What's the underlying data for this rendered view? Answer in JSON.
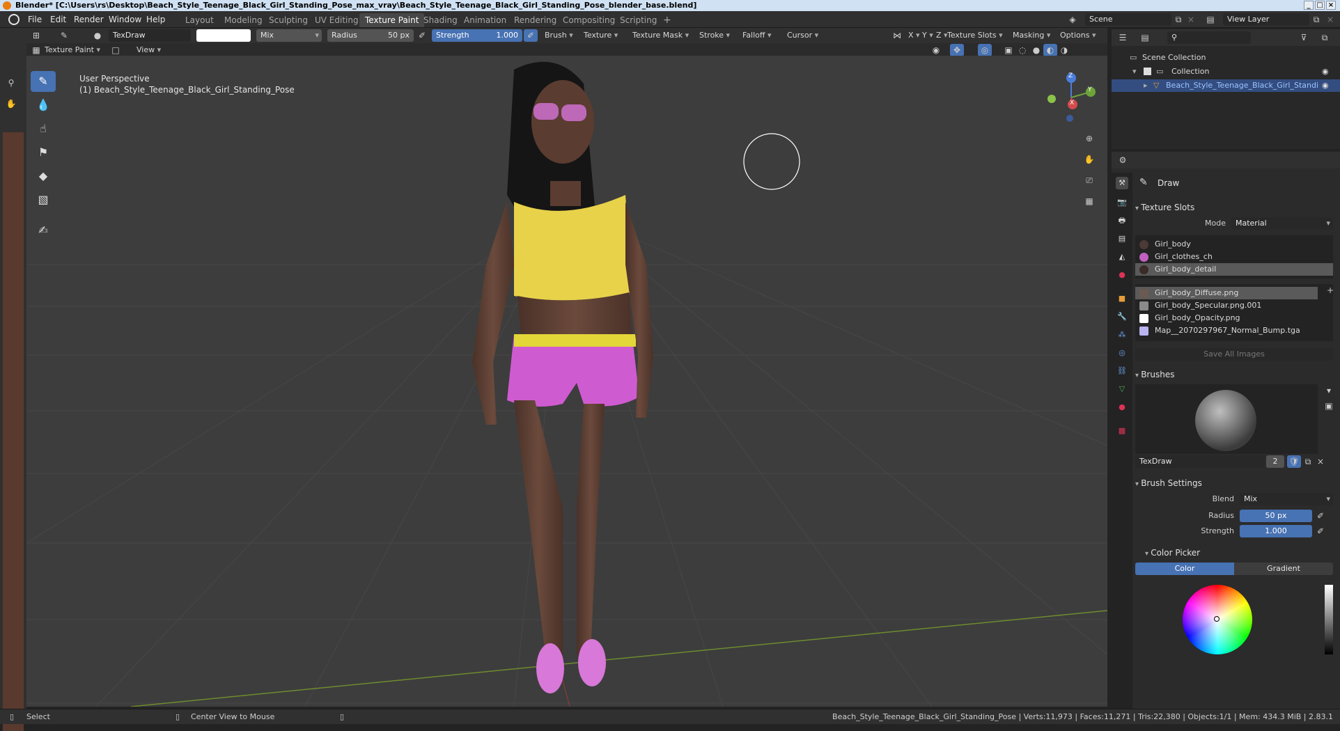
{
  "window": {
    "title": "Blender* [C:\\Users\\rs\\Desktop\\Beach_Style_Teenage_Black_Girl_Standing_Pose_max_vray\\Beach_Style_Teenage_Black_Girl_Standing_Pose_blender_base.blend]"
  },
  "menu": {
    "items": [
      "File",
      "Edit",
      "Render",
      "Window",
      "Help"
    ]
  },
  "workspaces": {
    "tabs": [
      "Layout",
      "Modeling",
      "Sculpting",
      "UV Editing",
      "Texture Paint",
      "Shading",
      "Animation",
      "Rendering",
      "Compositing",
      "Scripting"
    ],
    "active": "Texture Paint",
    "add": "+"
  },
  "scene": {
    "name": "Scene",
    "view_layer": "View Layer"
  },
  "tool_header": {
    "brush_name": "TexDraw",
    "blend": "Mix",
    "radius_label": "Radius",
    "radius_value": "50 px",
    "strength_label": "Strength",
    "strength_value": "1.000",
    "menus": [
      "Brush",
      "Texture",
      "Texture Mask",
      "Stroke",
      "Falloff",
      "Cursor"
    ],
    "axes": [
      "X",
      "Y",
      "Z"
    ],
    "right_menus": [
      "Texture Slots",
      "Masking",
      "Options"
    ]
  },
  "view_header": {
    "mode": "Texture Paint",
    "view_menu": "View"
  },
  "viewport": {
    "perspective": "User Perspective",
    "object_label": "(1) Beach_Style_Teenage_Black_Girl_Standing_Pose",
    "gizmo_axes": [
      "Z",
      "Y",
      "X"
    ]
  },
  "outliner": {
    "scene_collection": "Scene Collection",
    "collection": "Collection",
    "object": "Beach_Style_Teenage_Black_Girl_Standing_Pose"
  },
  "properties": {
    "tool_name": "Draw",
    "texture_slots": {
      "header": "Texture Slots",
      "mode_label": "Mode",
      "mode_value": "Material",
      "materials": [
        {
          "name": "Girl_body",
          "selected": false
        },
        {
          "name": "Girl_clothes_ch",
          "selected": false
        },
        {
          "name": "Girl_body_detail",
          "selected": true
        }
      ],
      "images": [
        {
          "name": "Girl_body_Diffuse.png",
          "selected": true,
          "color": "#6b5a52"
        },
        {
          "name": "Girl_body_Specular.png.001",
          "selected": false,
          "color": "#8a8a8a"
        },
        {
          "name": "Girl_body_Opacity.png",
          "selected": false,
          "color": "#ffffff"
        },
        {
          "name": "Map__2070297967_Normal_Bump.tga",
          "selected": false,
          "color": "#b9b3f0"
        }
      ],
      "save_all": "Save All Images"
    },
    "brushes": {
      "header": "Brushes",
      "brush_name": "TexDraw",
      "users": "2"
    },
    "brush_settings": {
      "header": "Brush Settings",
      "blend_label": "Blend",
      "blend_value": "Mix",
      "radius_label": "Radius",
      "radius_value": "50 px",
      "strength_label": "Strength",
      "strength_value": "1.000"
    },
    "color_picker": {
      "header": "Color Picker",
      "tabs": [
        "Color",
        "Gradient"
      ],
      "active": "Color"
    }
  },
  "statusbar": {
    "select": "Select",
    "center_view": "Center View to Mouse",
    "info": "Beach_Style_Teenage_Black_Girl_Standing_Pose | Verts:11,973 | Faces:11,271 | Tris:22,380 | Objects:1/1 | Mem: 434.3 MiB | 2.83.1"
  },
  "colors": {
    "accent": "#4772b3",
    "background": "#3d3d3d",
    "panel": "#2b2b2b",
    "brush_color": "#ffffff"
  }
}
